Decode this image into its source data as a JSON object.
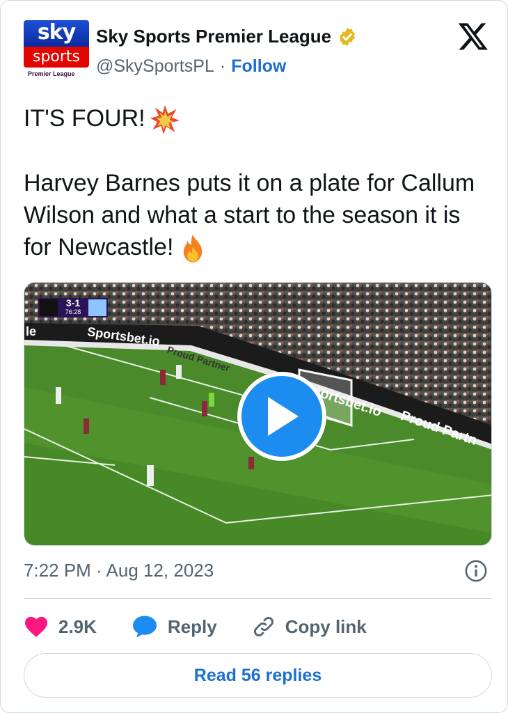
{
  "account": {
    "name": "Sky Sports Premier League",
    "handle": "@SkySportsPL",
    "separator": "·",
    "follow_label": "Follow",
    "avatar_top": "sky",
    "avatar_bottom": "sports",
    "avatar_caption": "Premier League"
  },
  "tweet": {
    "line1": "IT'S FOUR!",
    "line2": "Harvey Barnes puts it on a plate for Callum Wilson and what a start to the season it is for Newcastle!",
    "emoji1": "collision-emoji",
    "emoji2": "fire-emoji"
  },
  "media": {
    "type": "video",
    "scoreboard": {
      "score": "3-1",
      "clock": "76:28"
    },
    "ad_boards": [
      "Sportsbet.io",
      "Proud Partner",
      "Proud Partn"
    ],
    "board_fragment": "le"
  },
  "meta": {
    "time": "7:22 PM",
    "separator": "·",
    "date": "Aug 12, 2023"
  },
  "actions": {
    "likes": "2.9K",
    "reply_label": "Reply",
    "copy_label": "Copy link"
  },
  "read_replies_label": "Read 56 replies",
  "colors": {
    "link_blue": "#1d6fd1",
    "like_pink": "#f91880",
    "reply_blue": "#1d8cf0",
    "pitch_green": "#4f8f2a"
  }
}
